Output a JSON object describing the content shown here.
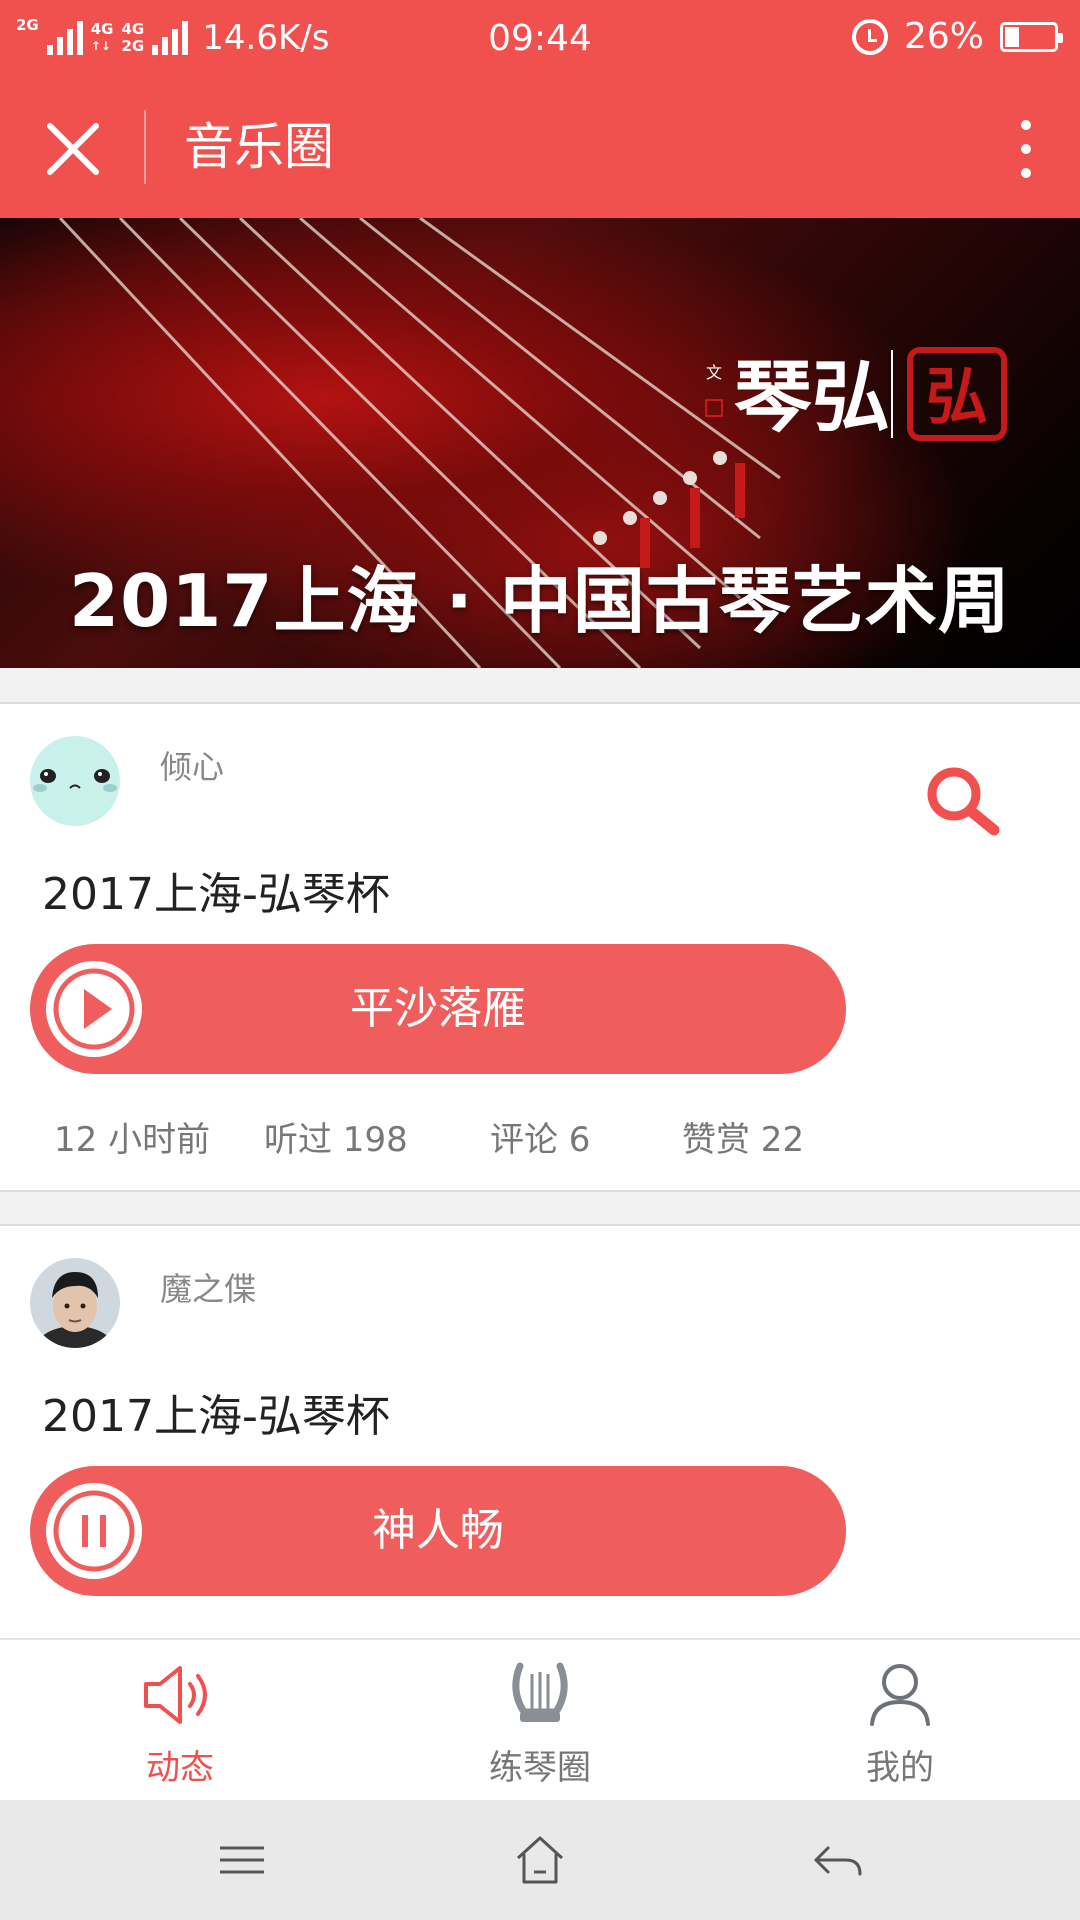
{
  "status_bar": {
    "net_label_1": "2G",
    "net_label_2a": "4G",
    "net_label_2b": "2G",
    "net_label_3": "4G",
    "speed": "14.6K/s",
    "time": "09:44",
    "battery": "26%",
    "battery_level": 0.26
  },
  "header": {
    "title": "音乐圈",
    "close_icon": "close-icon",
    "more_icon": "more-vertical-icon"
  },
  "banner": {
    "caption": "2017上海 · 中国古琴艺术周",
    "logo_text": "琴弘",
    "seal_text": "弘"
  },
  "feed": [
    {
      "username": "倾心",
      "title": "2017上海-弘琴杯",
      "track": "平沙落雁",
      "state": "play",
      "time_ago": "12 小时前",
      "listens": "听过 198",
      "comments": "评论 6",
      "rewards": "赞赏 22"
    },
    {
      "username": "魔之偞",
      "title": "2017上海-弘琴杯",
      "track": "神人畅",
      "state": "pause"
    }
  ],
  "tabs": [
    {
      "label": "动态",
      "icon": "speaker-icon",
      "active": true
    },
    {
      "label": "练琴圈",
      "icon": "lyre-icon",
      "active": false
    },
    {
      "label": "我的",
      "icon": "user-icon",
      "active": false
    }
  ],
  "colors": {
    "brand": "#f0514f",
    "pill": "#f05d5d",
    "nav_bg": "#e9e9e9"
  }
}
